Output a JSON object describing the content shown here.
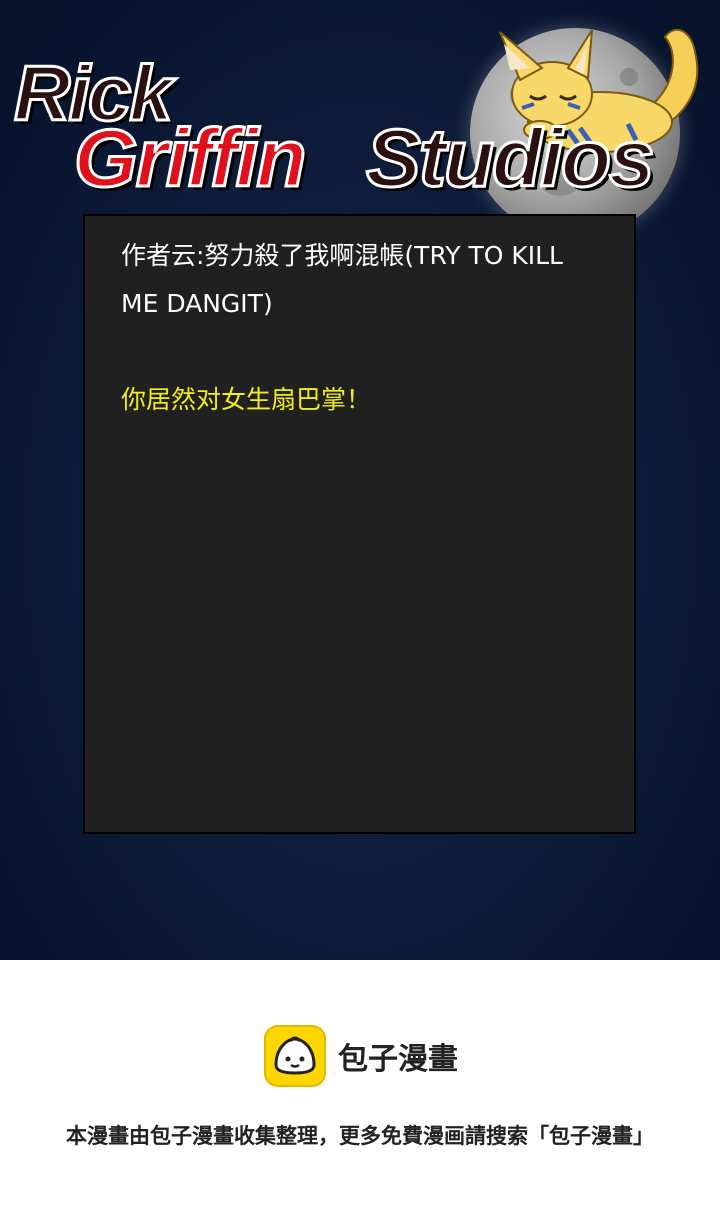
{
  "header": {
    "logo": {
      "word1": "Rick",
      "word2": "Griffin",
      "word3": "Studios",
      "colors": {
        "red": "#e0101c",
        "dark": "#2a1010",
        "outline": "#ffffff"
      }
    },
    "mascot_icon": "fox-on-moon-icon"
  },
  "panel": {
    "line1": "作者云:努力殺了我啊混帳(TRY TO KILL",
    "line2": "ME DANGIT)",
    "line3": "你居然对女生扇巴掌！",
    "colors": {
      "text": "#ffffff",
      "highlight": "#f2ee1a",
      "background": "#202020"
    }
  },
  "footer": {
    "brand_icon": "bao-bun-icon",
    "brand_name": "包子漫畫",
    "notice": "本漫畫由包子漫畫收集整理，更多免費漫画請搜索「包子漫畫」",
    "colors": {
      "icon": "#ffd600"
    }
  }
}
